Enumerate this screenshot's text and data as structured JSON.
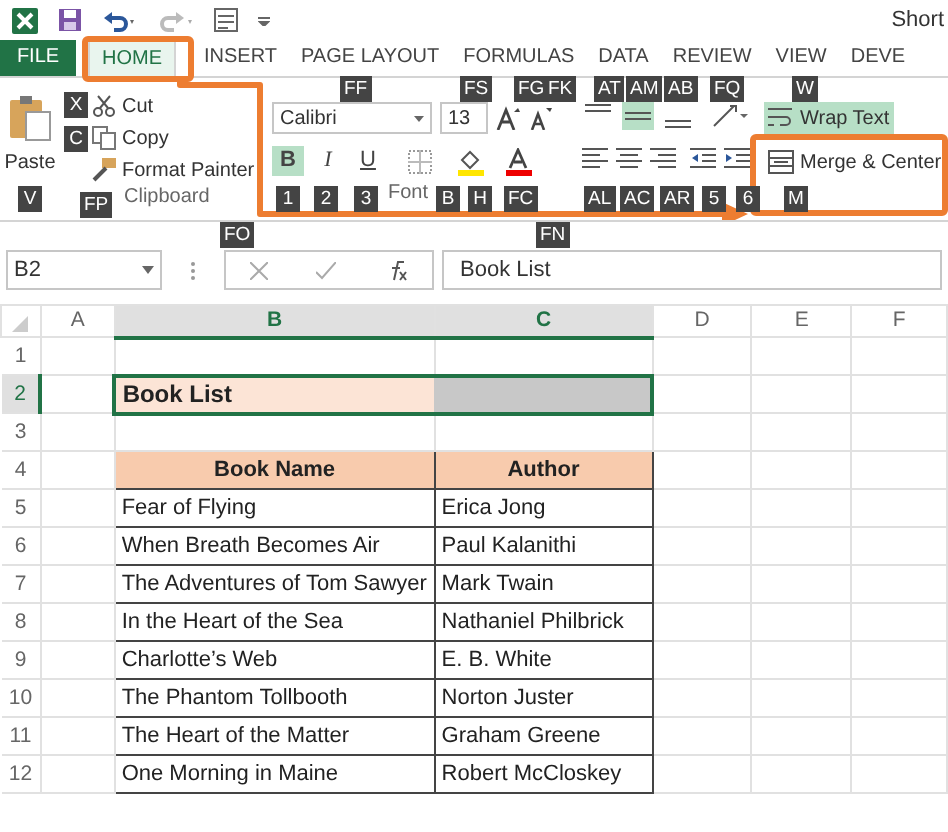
{
  "window": {
    "title": "Short"
  },
  "tabs": [
    {
      "label": "FILE",
      "selected": false,
      "kind": "file"
    },
    {
      "label": "HOME",
      "selected": true
    },
    {
      "label": "INSERT",
      "selected": false
    },
    {
      "label": "PAGE LAYOUT",
      "selected": false
    },
    {
      "label": "FORMULAS",
      "selected": false
    },
    {
      "label": "DATA",
      "selected": false
    },
    {
      "label": "REVIEW",
      "selected": false
    },
    {
      "label": "VIEW",
      "selected": false
    },
    {
      "label": "DEVE",
      "selected": false
    }
  ],
  "ribbon": {
    "clipboard": {
      "paste": "Paste",
      "cut": "Cut",
      "copy": "Copy",
      "format_painter": "Format Painter",
      "label": "Clipboard"
    },
    "font": {
      "name": "Calibri",
      "size": "13",
      "styles": [
        {
          "label": "B",
          "kind": "bold",
          "on": true
        },
        {
          "label": "I",
          "kind": "italic",
          "on": false
        },
        {
          "label": "U",
          "kind": "underline",
          "on": false
        }
      ],
      "label": "Font"
    },
    "alignment": {
      "align_top": false,
      "align_middle": true,
      "align_bottom": false,
      "wrap_text": {
        "label": "Wrap Text",
        "on": true
      },
      "merge": {
        "label": "Merge & Center",
        "on": false
      }
    }
  },
  "key_tips": [
    "X",
    "FF",
    "FS",
    "FG",
    "FK",
    "AT",
    "AM",
    "AB",
    "FQ",
    "W",
    "C",
    "V",
    "FP",
    "1",
    "2",
    "3",
    "B",
    "H",
    "FC",
    "AL",
    "AC",
    "AR",
    "5",
    "6",
    "M",
    "FO",
    "FN"
  ],
  "formula_bar": {
    "name_box": "B2",
    "formula": "Book List"
  },
  "sheet": {
    "columns": [
      {
        "label": "A",
        "selected": false
      },
      {
        "label": "B",
        "selected": true
      },
      {
        "label": "C",
        "selected": true
      },
      {
        "label": "D",
        "selected": false
      },
      {
        "label": "E",
        "selected": false
      },
      {
        "label": "F",
        "selected": false
      }
    ],
    "rows": [
      {
        "number": "1",
        "selected": false
      },
      {
        "number": "2",
        "selected": true,
        "kind": "title",
        "book": "Book List"
      },
      {
        "number": "3",
        "selected": false
      },
      {
        "number": "4",
        "selected": false,
        "kind": "header",
        "book": "Book Name",
        "author": "Author"
      },
      {
        "number": "5",
        "selected": false,
        "kind": "data",
        "book": "Fear of Flying",
        "author": "Erica Jong"
      },
      {
        "number": "6",
        "selected": false,
        "kind": "data",
        "book": "When Breath Becomes Air",
        "author": "Paul Kalanithi"
      },
      {
        "number": "7",
        "selected": false,
        "kind": "data",
        "book": "The Adventures of Tom Sawyer",
        "author": "Mark Twain"
      },
      {
        "number": "8",
        "selected": false,
        "kind": "data",
        "book": "In the Heart of the Sea",
        "author": "Nathaniel Philbrick"
      },
      {
        "number": "9",
        "selected": false,
        "kind": "data",
        "book": "Charlotte’s Web",
        "author": "E. B. White"
      },
      {
        "number": "10",
        "selected": false,
        "kind": "data",
        "book": "The Phantom Tollbooth",
        "author": "Norton Juster"
      },
      {
        "number": "11",
        "selected": false,
        "kind": "data",
        "book": "The Heart of the Matter",
        "author": "Graham Greene"
      },
      {
        "number": "12",
        "selected": false,
        "kind": "data",
        "book": "One Morning in Maine",
        "author": "Robert McCloskey"
      }
    ]
  }
}
